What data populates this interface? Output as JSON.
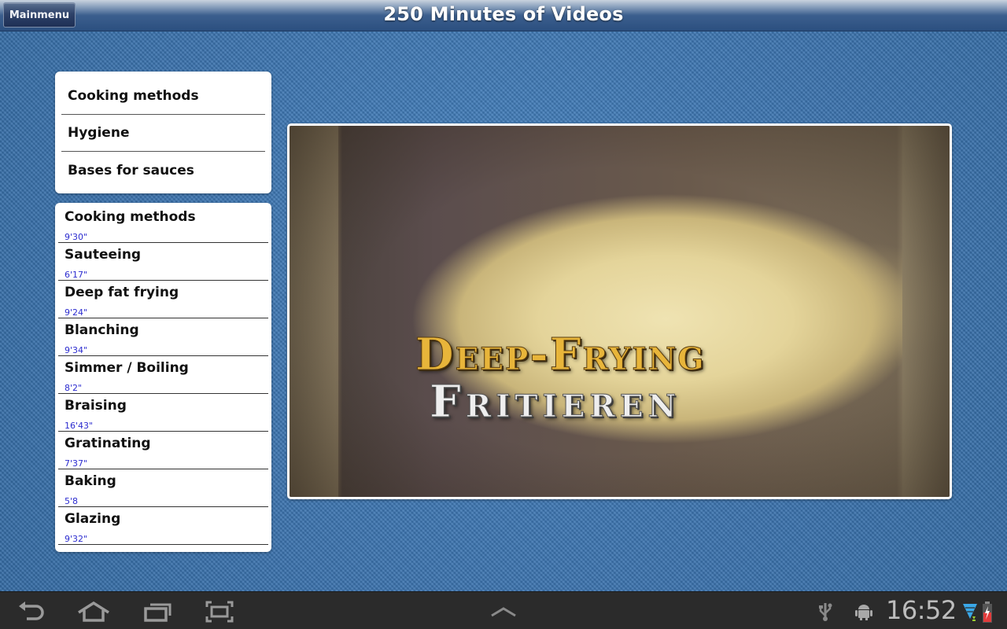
{
  "action_bar": {
    "mainmenu_label": "Mainmenu",
    "title": "250 Minutes of Videos"
  },
  "categories": [
    {
      "label": "Cooking methods"
    },
    {
      "label": "Hygiene"
    },
    {
      "label": "Bases for sauces"
    }
  ],
  "videos": [
    {
      "title": "Cooking methods",
      "duration": "9'30\""
    },
    {
      "title": "Sauteeing",
      "duration": "6'17\""
    },
    {
      "title": "Deep fat frying",
      "duration": "9'24\""
    },
    {
      "title": "Blanching",
      "duration": "9'34\""
    },
    {
      "title": "Simmer / Boiling",
      "duration": "8'2\""
    },
    {
      "title": "Braising",
      "duration": "16'43\""
    },
    {
      "title": "Gratinating",
      "duration": "7'37\""
    },
    {
      "title": "Baking",
      "duration": "5'8"
    },
    {
      "title": "Glazing",
      "duration": "9'32\""
    }
  ],
  "player": {
    "overlay_line1": "Deep-Frying",
    "overlay_line2": "Fritieren"
  },
  "system_bar": {
    "nav_icons": [
      "back-icon",
      "home-icon",
      "recent-apps-icon",
      "screenshot-icon"
    ],
    "center_icon": "chevron-up-icon",
    "status_icons": [
      "usb-icon",
      "android-debug-icon",
      "wifi-icon",
      "battery-charging-icon"
    ],
    "clock": "16:52"
  },
  "colors": {
    "duration_text": "#2c2ccf",
    "background_denim": "#3a72ad",
    "system_bar": "#2b2b2b",
    "action_bar": "#2b4f7f"
  }
}
